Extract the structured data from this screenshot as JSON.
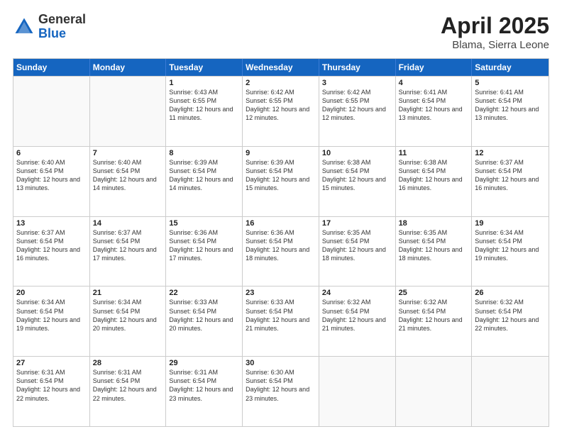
{
  "header": {
    "logo": {
      "general": "General",
      "blue": "Blue"
    },
    "title": "April 2025",
    "location": "Blama, Sierra Leone"
  },
  "weekdays": [
    "Sunday",
    "Monday",
    "Tuesday",
    "Wednesday",
    "Thursday",
    "Friday",
    "Saturday"
  ],
  "weeks": [
    [
      {
        "day": "",
        "info": ""
      },
      {
        "day": "",
        "info": ""
      },
      {
        "day": "1",
        "info": "Sunrise: 6:43 AM\nSunset: 6:55 PM\nDaylight: 12 hours and 11 minutes."
      },
      {
        "day": "2",
        "info": "Sunrise: 6:42 AM\nSunset: 6:55 PM\nDaylight: 12 hours and 12 minutes."
      },
      {
        "day": "3",
        "info": "Sunrise: 6:42 AM\nSunset: 6:55 PM\nDaylight: 12 hours and 12 minutes."
      },
      {
        "day": "4",
        "info": "Sunrise: 6:41 AM\nSunset: 6:54 PM\nDaylight: 12 hours and 13 minutes."
      },
      {
        "day": "5",
        "info": "Sunrise: 6:41 AM\nSunset: 6:54 PM\nDaylight: 12 hours and 13 minutes."
      }
    ],
    [
      {
        "day": "6",
        "info": "Sunrise: 6:40 AM\nSunset: 6:54 PM\nDaylight: 12 hours and 13 minutes."
      },
      {
        "day": "7",
        "info": "Sunrise: 6:40 AM\nSunset: 6:54 PM\nDaylight: 12 hours and 14 minutes."
      },
      {
        "day": "8",
        "info": "Sunrise: 6:39 AM\nSunset: 6:54 PM\nDaylight: 12 hours and 14 minutes."
      },
      {
        "day": "9",
        "info": "Sunrise: 6:39 AM\nSunset: 6:54 PM\nDaylight: 12 hours and 15 minutes."
      },
      {
        "day": "10",
        "info": "Sunrise: 6:38 AM\nSunset: 6:54 PM\nDaylight: 12 hours and 15 minutes."
      },
      {
        "day": "11",
        "info": "Sunrise: 6:38 AM\nSunset: 6:54 PM\nDaylight: 12 hours and 16 minutes."
      },
      {
        "day": "12",
        "info": "Sunrise: 6:37 AM\nSunset: 6:54 PM\nDaylight: 12 hours and 16 minutes."
      }
    ],
    [
      {
        "day": "13",
        "info": "Sunrise: 6:37 AM\nSunset: 6:54 PM\nDaylight: 12 hours and 16 minutes."
      },
      {
        "day": "14",
        "info": "Sunrise: 6:37 AM\nSunset: 6:54 PM\nDaylight: 12 hours and 17 minutes."
      },
      {
        "day": "15",
        "info": "Sunrise: 6:36 AM\nSunset: 6:54 PM\nDaylight: 12 hours and 17 minutes."
      },
      {
        "day": "16",
        "info": "Sunrise: 6:36 AM\nSunset: 6:54 PM\nDaylight: 12 hours and 18 minutes."
      },
      {
        "day": "17",
        "info": "Sunrise: 6:35 AM\nSunset: 6:54 PM\nDaylight: 12 hours and 18 minutes."
      },
      {
        "day": "18",
        "info": "Sunrise: 6:35 AM\nSunset: 6:54 PM\nDaylight: 12 hours and 18 minutes."
      },
      {
        "day": "19",
        "info": "Sunrise: 6:34 AM\nSunset: 6:54 PM\nDaylight: 12 hours and 19 minutes."
      }
    ],
    [
      {
        "day": "20",
        "info": "Sunrise: 6:34 AM\nSunset: 6:54 PM\nDaylight: 12 hours and 19 minutes."
      },
      {
        "day": "21",
        "info": "Sunrise: 6:34 AM\nSunset: 6:54 PM\nDaylight: 12 hours and 20 minutes."
      },
      {
        "day": "22",
        "info": "Sunrise: 6:33 AM\nSunset: 6:54 PM\nDaylight: 12 hours and 20 minutes."
      },
      {
        "day": "23",
        "info": "Sunrise: 6:33 AM\nSunset: 6:54 PM\nDaylight: 12 hours and 21 minutes."
      },
      {
        "day": "24",
        "info": "Sunrise: 6:32 AM\nSunset: 6:54 PM\nDaylight: 12 hours and 21 minutes."
      },
      {
        "day": "25",
        "info": "Sunrise: 6:32 AM\nSunset: 6:54 PM\nDaylight: 12 hours and 21 minutes."
      },
      {
        "day": "26",
        "info": "Sunrise: 6:32 AM\nSunset: 6:54 PM\nDaylight: 12 hours and 22 minutes."
      }
    ],
    [
      {
        "day": "27",
        "info": "Sunrise: 6:31 AM\nSunset: 6:54 PM\nDaylight: 12 hours and 22 minutes."
      },
      {
        "day": "28",
        "info": "Sunrise: 6:31 AM\nSunset: 6:54 PM\nDaylight: 12 hours and 22 minutes."
      },
      {
        "day": "29",
        "info": "Sunrise: 6:31 AM\nSunset: 6:54 PM\nDaylight: 12 hours and 23 minutes."
      },
      {
        "day": "30",
        "info": "Sunrise: 6:30 AM\nSunset: 6:54 PM\nDaylight: 12 hours and 23 minutes."
      },
      {
        "day": "",
        "info": ""
      },
      {
        "day": "",
        "info": ""
      },
      {
        "day": "",
        "info": ""
      }
    ]
  ]
}
